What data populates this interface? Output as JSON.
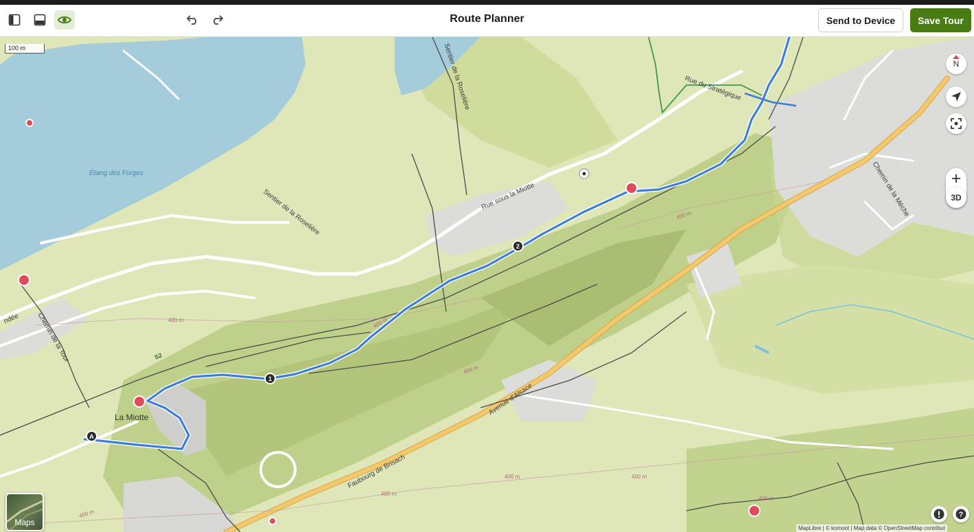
{
  "header": {
    "title": "Route Planner",
    "send_label": "Send to Device",
    "save_label": "Save Tour",
    "accent_color": "#4a7c14"
  },
  "icons": {
    "toolbar": [
      "sidebar-left-icon",
      "panel-bottom-icon",
      "eye-icon",
      "undo-icon",
      "redo-icon"
    ],
    "map_controls": [
      "compass-icon",
      "locate-icon",
      "recenter-icon",
      "zoom-in-icon",
      "zoom-out-icon"
    ]
  },
  "map": {
    "scale_label": "100 m",
    "compass_label": "N",
    "view_3d_label": "3D",
    "layer_label": "Maps",
    "attribution": "MapLibre | © komoot | Map data © OpenStreetMap contribut",
    "labels": {
      "lake": "Étang des Forges",
      "sentier_1": "Sentier de la Roselière",
      "sentier_2": "Sentier de la Roselière",
      "rue_miotte": "Rue sous la Miotte",
      "rue_strategique": "Rue du Stratégique",
      "chemin_tour": "Chemin de la Tour",
      "chemin_meche": "Chemin de la Mèche",
      "avenue_alsace": "Avenue d'Alsace",
      "faubourg": "Faubourg de Brisach",
      "place": "La Miotte",
      "partial_left": "ndée",
      "path_ref": "S2",
      "contour_1": "400 m",
      "contour_2": "400 m",
      "contour_3": "400 m",
      "contour_4": "400 m",
      "contour_5": "400 m",
      "contour_6": "400 m",
      "contour_7": "400 m",
      "contour_8": "400 m",
      "contour_9": "400 m"
    },
    "waypoints": {
      "start": "A",
      "wp1": "1",
      "wp2": "2"
    },
    "route_color": "#3b7ddd"
  }
}
